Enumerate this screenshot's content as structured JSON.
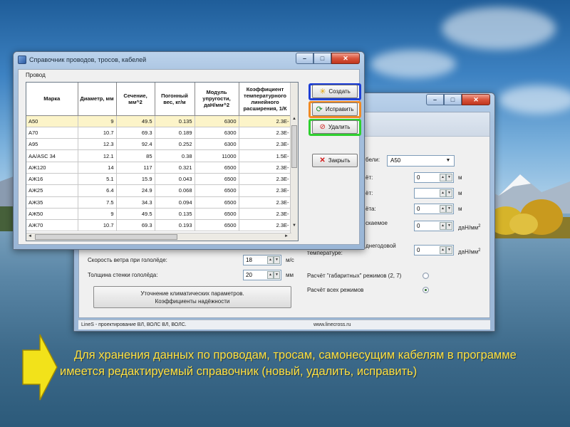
{
  "front_window": {
    "title": "Справочник проводов, тросов, кабелей",
    "group_label": "Провод",
    "columns": [
      "Марка",
      "Диаметр, мм",
      "Сечение, мм^2",
      "Погонный вес, кг/м",
      "Модуль упругости, даН/мм^2",
      "Коэффициент температурного линейного расширения, 1/К"
    ],
    "rows": [
      [
        "A50",
        "9",
        "49.5",
        "0.135",
        "6300",
        "2.3E-"
      ],
      [
        "A70",
        "10.7",
        "69.3",
        "0.189",
        "6300",
        "2.3E-"
      ],
      [
        "A95",
        "12.3",
        "92.4",
        "0.252",
        "6300",
        "2.3E-"
      ],
      [
        "AA/ASC 34",
        "12.1",
        "85",
        "0.38",
        "11000",
        "1.5E-"
      ],
      [
        "АЖ120",
        "14",
        "117",
        "0.321",
        "6500",
        "2.3E-"
      ],
      [
        "АЖ16",
        "5.1",
        "15.9",
        "0.043",
        "6500",
        "2.3E-"
      ],
      [
        "АЖ25",
        "6.4",
        "24.9",
        "0.068",
        "6500",
        "2.3E-"
      ],
      [
        "АЖ35",
        "7.5",
        "34.3",
        "0.094",
        "6500",
        "2.3E-"
      ],
      [
        "АЖ50",
        "9",
        "49.5",
        "0.135",
        "6500",
        "2.3E-"
      ],
      [
        "АЖ70",
        "10.7",
        "69.3",
        "0.193",
        "6500",
        "2.3E-"
      ]
    ],
    "buttons": {
      "create": "Создать",
      "edit": "Исправить",
      "delete": "Удалить",
      "close": "Закрыть"
    },
    "colors": {
      "create_highlight": "#1e3fd6",
      "edit_highlight": "#f08a24",
      "delete_highlight": "#2fd02f"
    }
  },
  "back_window": {
    "labels": {
      "cable_partial": "бели:",
      "row1": "ёт:",
      "row2": "ёт:",
      "row3": "ёта:",
      "row4": "скаемое",
      "row5_a": "днегодовой",
      "row5_b": "температуре:",
      "wind_glaze": "Скорость ветра при гололёде:",
      "glaze_thickness": "Толщина стенки гололёда:",
      "calc_dimensional": "Расчёт \"габаритных\" режимов (2, 7)",
      "calc_all": "Расчёт всех режимов"
    },
    "combo_value": "A50",
    "spin_values": {
      "s1": "0",
      "s2": "",
      "s3": "0",
      "s4": "0",
      "s5": "0",
      "wind": "18",
      "thickness": "20"
    },
    "units": {
      "m": "м",
      "dan_mm2": "даН/мм",
      "sup2": "2",
      "ms": "м/с",
      "mm": "мм"
    },
    "big_button": {
      "line1": "Уточнение климатических параметров.",
      "line2": "Коэффициенты надёжности"
    },
    "status": {
      "left": "LineS - проектирование ВЛ, ВОЛС ВЛ, ВОЛС.",
      "right": "www.linecross.ru"
    }
  },
  "caption": {
    "text": "Для хранения данных по проводам, тросам, самонесущим кабелям в программе имеется редактируемый справочник (новый, удалить, исправить)"
  }
}
